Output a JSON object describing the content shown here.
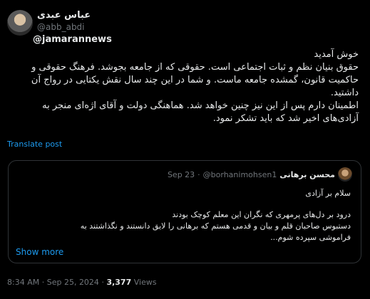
{
  "author": {
    "display_name": "عباس عبدی",
    "handle": "@abb_abdi"
  },
  "mention": "@jamarannews",
  "body": {
    "line1": "خوش آمدید",
    "line2": "حقوق بنیان نظم و ثبات اجتماعی است. حقوقی که از جامعه بجوشد. فرهنگ حقوقی و حاکمیت قانون، گمشده جامعه ماست. و شما در این چند سال نقش یکتایی در رواج آن داشتید.",
    "line3": "اطمینان دارم پس از این نیز چنین خواهد شد. هماهنگی دولت و آقای اژه‌ای منجر به آزادی‌های اخیر شد که باید تشکر نمود."
  },
  "translate_label": "Translate post",
  "quote": {
    "display_name": "محسن برهانی",
    "handle": "@borhanimohsen1",
    "separator": "·",
    "date": "Sep 23",
    "greeting": "سلام بر آزادی",
    "text1": "درود بر دل‌های پرمهری که نگران این معلم کوچک بودند",
    "text2": "دستبوس صاحبان قلم و بیان و قدمی هستم که برهانی را لایق دانستند و نگذاشتند به",
    "text3": "فراموشی سپرده شوم...",
    "show_more": "Show more"
  },
  "meta": {
    "time": "8:34 AM",
    "dot1": "·",
    "date": "Sep 25, 2024",
    "dot2": "·",
    "views_count": "3,377",
    "views_label": "Views"
  }
}
